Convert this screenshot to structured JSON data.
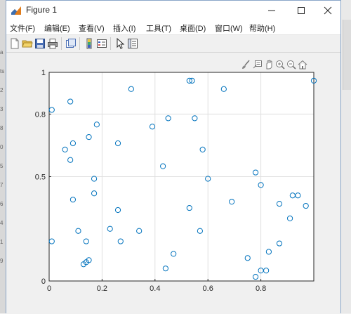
{
  "window": {
    "title": "Figure 1"
  },
  "menu": [
    "文件(F)",
    "编辑(E)",
    "查看(V)",
    "插入(I)",
    "工具(T)",
    "桌面(D)",
    "窗口(W)",
    "帮助(H)"
  ],
  "toolbar_icons": [
    "new-figure-icon",
    "open-file-icon",
    "save-icon",
    "print-icon",
    "link-plot-icon",
    "insert-colorbar-icon",
    "insert-legend-icon",
    "pointer-icon",
    "property-editor-icon"
  ],
  "axes_toolbar_icons": [
    "brush-icon",
    "data-tips-icon",
    "pan-icon",
    "zoom-in-icon",
    "zoom-out-icon",
    "home-icon"
  ],
  "background_window_fragments": [
    "a",
    "ts",
    "2",
    "3",
    "8",
    "0",
    "5",
    "7",
    "6",
    "4",
    "1",
    "9"
  ],
  "chart_data": {
    "type": "scatter",
    "xlim": [
      0,
      1
    ],
    "ylim": [
      0,
      1
    ],
    "xticks": [
      "0",
      "0.2",
      "0.4",
      "0.6",
      "0.8"
    ],
    "yticks": [
      "0",
      "0.5",
      "0.8",
      "1"
    ],
    "ytick_values": [
      0,
      0.5,
      0.8,
      1
    ],
    "grid": true,
    "marker": "circle-open",
    "marker_color": "#0072bd",
    "points": [
      {
        "x": 0.01,
        "y": 0.82
      },
      {
        "x": 0.01,
        "y": 0.19
      },
      {
        "x": 0.06,
        "y": 0.63
      },
      {
        "x": 0.08,
        "y": 0.86
      },
      {
        "x": 0.08,
        "y": 0.58
      },
      {
        "x": 0.09,
        "y": 0.66
      },
      {
        "x": 0.09,
        "y": 0.39
      },
      {
        "x": 0.11,
        "y": 0.24
      },
      {
        "x": 0.13,
        "y": 0.08
      },
      {
        "x": 0.14,
        "y": 0.19
      },
      {
        "x": 0.14,
        "y": 0.09
      },
      {
        "x": 0.15,
        "y": 0.69
      },
      {
        "x": 0.15,
        "y": 0.1
      },
      {
        "x": 0.17,
        "y": 0.49
      },
      {
        "x": 0.17,
        "y": 0.42
      },
      {
        "x": 0.18,
        "y": 0.75
      },
      {
        "x": 0.23,
        "y": 0.25
      },
      {
        "x": 0.26,
        "y": 0.66
      },
      {
        "x": 0.26,
        "y": 0.34
      },
      {
        "x": 0.27,
        "y": 0.19
      },
      {
        "x": 0.31,
        "y": 0.92
      },
      {
        "x": 0.34,
        "y": 0.24
      },
      {
        "x": 0.39,
        "y": 0.74
      },
      {
        "x": 0.43,
        "y": 0.55
      },
      {
        "x": 0.44,
        "y": 0.06
      },
      {
        "x": 0.45,
        "y": 0.78
      },
      {
        "x": 0.47,
        "y": 0.13
      },
      {
        "x": 0.53,
        "y": 0.96
      },
      {
        "x": 0.54,
        "y": 0.96
      },
      {
        "x": 0.53,
        "y": 0.35
      },
      {
        "x": 0.55,
        "y": 0.78
      },
      {
        "x": 0.57,
        "y": 0.24
      },
      {
        "x": 0.58,
        "y": 0.63
      },
      {
        "x": 0.6,
        "y": 0.49
      },
      {
        "x": 0.66,
        "y": 0.92
      },
      {
        "x": 0.69,
        "y": 0.38
      },
      {
        "x": 0.75,
        "y": 0.11
      },
      {
        "x": 0.78,
        "y": 0.52
      },
      {
        "x": 0.78,
        "y": 0.02
      },
      {
        "x": 0.8,
        "y": 0.46
      },
      {
        "x": 0.8,
        "y": 0.05
      },
      {
        "x": 0.82,
        "y": 0.05
      },
      {
        "x": 0.83,
        "y": 0.14
      },
      {
        "x": 0.87,
        "y": 0.18
      },
      {
        "x": 0.87,
        "y": 0.37
      },
      {
        "x": 0.91,
        "y": 0.3
      },
      {
        "x": 0.92,
        "y": 0.41
      },
      {
        "x": 0.94,
        "y": 0.41
      },
      {
        "x": 0.97,
        "y": 0.36
      },
      {
        "x": 1.0,
        "y": 0.96
      }
    ]
  }
}
